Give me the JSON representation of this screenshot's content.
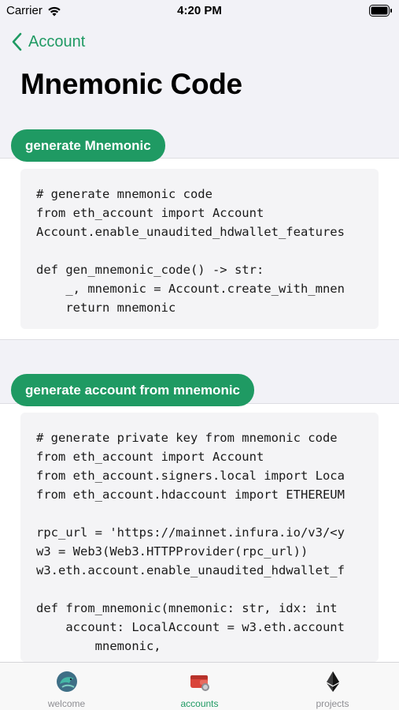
{
  "status_bar": {
    "carrier": "Carrier",
    "time": "4:20 PM"
  },
  "nav": {
    "back_label": "Account"
  },
  "page": {
    "title": "Mnemonic Code"
  },
  "sections": [
    {
      "button_label": "generate Mnemonic",
      "code_lines": [
        "# generate mnemonic code",
        "from eth_account import Account",
        "Account.enable_unaudited_hdwallet_features",
        "",
        "def gen_mnemonic_code() -> str:",
        "    _, mnemonic = Account.create_with_mnen",
        "    return mnemonic"
      ]
    },
    {
      "button_label": "generate account from mnemonic",
      "code_lines": [
        "# generate private key from mnemonic code",
        "from eth_account import Account",
        "from eth_account.signers.local import Loca",
        "from eth_account.hdaccount import ETHEREUM",
        "",
        "rpc_url = 'https://mainnet.infura.io/v3/<y",
        "w3 = Web3(Web3.HTTPProvider(rpc_url))",
        "w3.eth.account.enable_unaudited_hdwallet_f",
        "",
        "def from_mnemonic(mnemonic: str, idx: int",
        "    account: LocalAccount = w3.eth.account",
        "        mnemonic,"
      ]
    }
  ],
  "tabs": [
    {
      "label": "welcome",
      "icon": "dolphin-icon"
    },
    {
      "label": "accounts",
      "icon": "wallet-icon"
    },
    {
      "label": "projects",
      "icon": "ethereum-icon"
    }
  ],
  "active_tab": "accounts",
  "colors": {
    "accent": "#1f9a63",
    "background": "#f2f2f7",
    "code_bg": "#f4f4f6"
  }
}
